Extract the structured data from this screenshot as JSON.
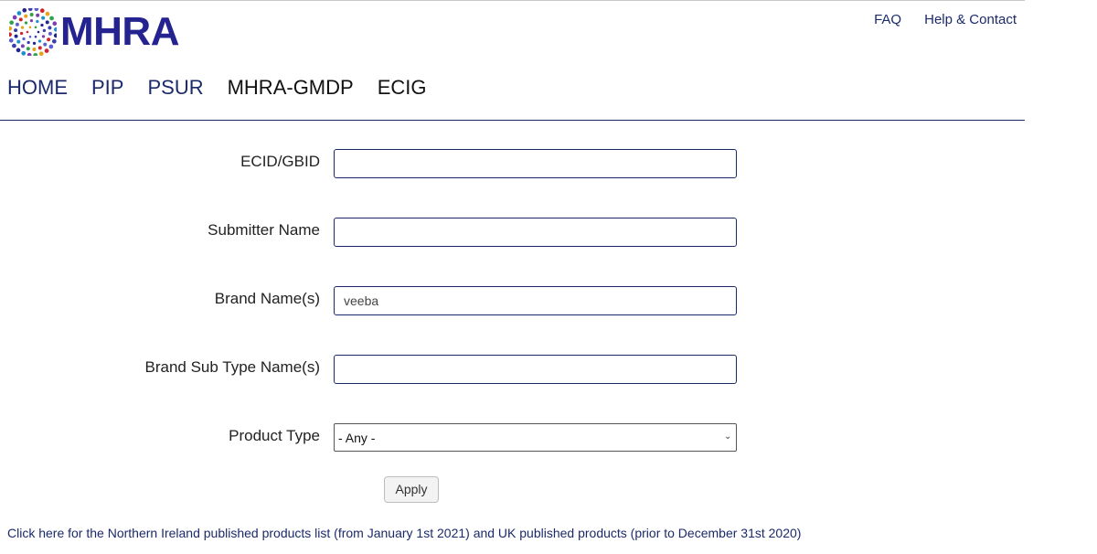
{
  "header": {
    "logo_text": "MHRA",
    "utility_links": [
      "FAQ",
      "Help & Contact"
    ]
  },
  "nav": {
    "items": [
      "HOME",
      "PIP",
      "PSUR",
      "MHRA-GMDP",
      "ECIG"
    ]
  },
  "form": {
    "fields": [
      {
        "label": "ECID/GBID",
        "value": ""
      },
      {
        "label": "Submitter Name",
        "value": ""
      },
      {
        "label": "Brand Name(s)",
        "value": "veeba"
      },
      {
        "label": "Brand Sub Type Name(s)",
        "value": ""
      }
    ],
    "product_type": {
      "label": "Product Type",
      "selected": "- Any -"
    },
    "apply_label": "Apply"
  },
  "footer": {
    "link_text": "Click here for the Northern Ireland published products list (from January 1st 2021) and UK published products (prior to December 31st 2020)"
  },
  "colors": {
    "brand": "#25238f",
    "link": "#1b2a6b"
  }
}
